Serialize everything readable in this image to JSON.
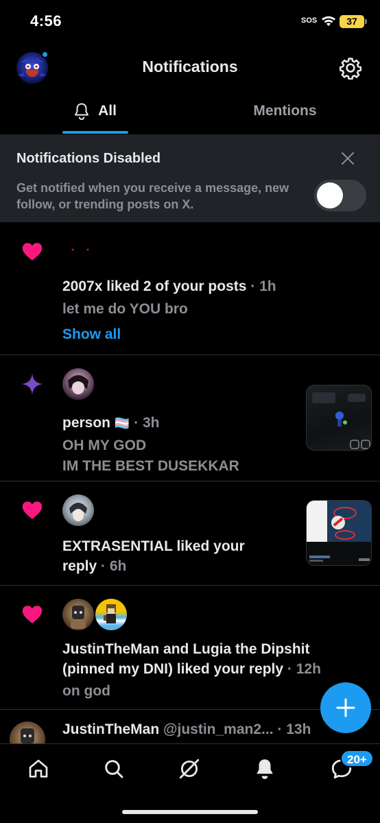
{
  "status_bar": {
    "time": "4:56",
    "sos": "SOS",
    "battery": "37"
  },
  "header": {
    "title": "Notifications",
    "avatar_icon": "profile-avatar",
    "settings_icon": "gear-icon"
  },
  "tabs": [
    {
      "label": "All",
      "active": true
    },
    {
      "label": "Mentions",
      "active": false
    }
  ],
  "banner": {
    "title": "Notifications Disabled",
    "text": "Get notified when you receive a message, new follow, or trending posts on X.",
    "toggle_on": false
  },
  "notifications": [
    {
      "icon": "heart-icon",
      "text": "2007x liked 2 of your posts",
      "time": "· 1h",
      "sub": "let me do YOU bro",
      "action": "Show all"
    },
    {
      "icon": "sparkle-icon",
      "name": "person",
      "flag": "🏳️‍⚧️",
      "time": "· 3h",
      "sub_lines": [
        "OH MY GOD",
        "IM THE BEST DUSEKKAR"
      ]
    },
    {
      "icon": "heart-icon",
      "text_line1": "EXTRASENTIAL liked your",
      "text_line2": "reply",
      "time": "· 6h"
    },
    {
      "icon": "heart-icon",
      "text_line1": "JustinTheMan and Lugia the Dipshit",
      "text_line2": "(pinned my DNI) liked your reply",
      "time": "· 12h",
      "sub": "on god"
    },
    {
      "name": "JustinTheMan",
      "handle": "@justin_man2...",
      "time": "· 13h"
    }
  ],
  "bottom_nav": {
    "items": [
      "home-icon",
      "search-icon",
      "grok-icon",
      "notifications-bell-icon",
      "messages-icon"
    ],
    "messages_badge": "20+"
  },
  "colors": {
    "accent": "#1d9bf0",
    "heart": "#f91880",
    "sparkle": "#794bc4",
    "banner_bg": "#202327"
  }
}
